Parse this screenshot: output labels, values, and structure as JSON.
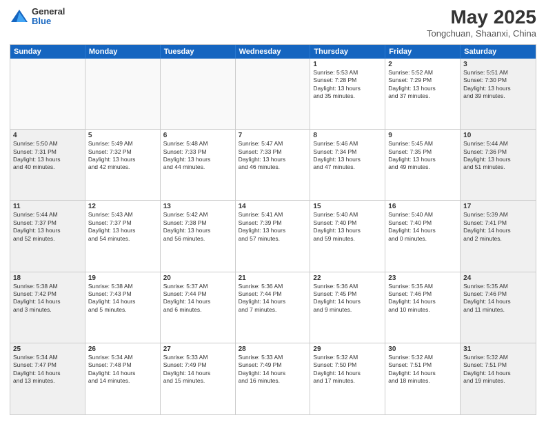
{
  "logo": {
    "general": "General",
    "blue": "Blue"
  },
  "title": "May 2025",
  "location": "Tongchuan, Shaanxi, China",
  "header_days": [
    "Sunday",
    "Monday",
    "Tuesday",
    "Wednesday",
    "Thursday",
    "Friday",
    "Saturday"
  ],
  "weeks": [
    [
      {
        "day": "",
        "info": ""
      },
      {
        "day": "",
        "info": ""
      },
      {
        "day": "",
        "info": ""
      },
      {
        "day": "",
        "info": ""
      },
      {
        "day": "1",
        "info": "Sunrise: 5:53 AM\nSunset: 7:28 PM\nDaylight: 13 hours\nand 35 minutes."
      },
      {
        "day": "2",
        "info": "Sunrise: 5:52 AM\nSunset: 7:29 PM\nDaylight: 13 hours\nand 37 minutes."
      },
      {
        "day": "3",
        "info": "Sunrise: 5:51 AM\nSunset: 7:30 PM\nDaylight: 13 hours\nand 39 minutes."
      }
    ],
    [
      {
        "day": "4",
        "info": "Sunrise: 5:50 AM\nSunset: 7:31 PM\nDaylight: 13 hours\nand 40 minutes."
      },
      {
        "day": "5",
        "info": "Sunrise: 5:49 AM\nSunset: 7:32 PM\nDaylight: 13 hours\nand 42 minutes."
      },
      {
        "day": "6",
        "info": "Sunrise: 5:48 AM\nSunset: 7:33 PM\nDaylight: 13 hours\nand 44 minutes."
      },
      {
        "day": "7",
        "info": "Sunrise: 5:47 AM\nSunset: 7:33 PM\nDaylight: 13 hours\nand 46 minutes."
      },
      {
        "day": "8",
        "info": "Sunrise: 5:46 AM\nSunset: 7:34 PM\nDaylight: 13 hours\nand 47 minutes."
      },
      {
        "day": "9",
        "info": "Sunrise: 5:45 AM\nSunset: 7:35 PM\nDaylight: 13 hours\nand 49 minutes."
      },
      {
        "day": "10",
        "info": "Sunrise: 5:44 AM\nSunset: 7:36 PM\nDaylight: 13 hours\nand 51 minutes."
      }
    ],
    [
      {
        "day": "11",
        "info": "Sunrise: 5:44 AM\nSunset: 7:37 PM\nDaylight: 13 hours\nand 52 minutes."
      },
      {
        "day": "12",
        "info": "Sunrise: 5:43 AM\nSunset: 7:37 PM\nDaylight: 13 hours\nand 54 minutes."
      },
      {
        "day": "13",
        "info": "Sunrise: 5:42 AM\nSunset: 7:38 PM\nDaylight: 13 hours\nand 56 minutes."
      },
      {
        "day": "14",
        "info": "Sunrise: 5:41 AM\nSunset: 7:39 PM\nDaylight: 13 hours\nand 57 minutes."
      },
      {
        "day": "15",
        "info": "Sunrise: 5:40 AM\nSunset: 7:40 PM\nDaylight: 13 hours\nand 59 minutes."
      },
      {
        "day": "16",
        "info": "Sunrise: 5:40 AM\nSunset: 7:40 PM\nDaylight: 14 hours\nand 0 minutes."
      },
      {
        "day": "17",
        "info": "Sunrise: 5:39 AM\nSunset: 7:41 PM\nDaylight: 14 hours\nand 2 minutes."
      }
    ],
    [
      {
        "day": "18",
        "info": "Sunrise: 5:38 AM\nSunset: 7:42 PM\nDaylight: 14 hours\nand 3 minutes."
      },
      {
        "day": "19",
        "info": "Sunrise: 5:38 AM\nSunset: 7:43 PM\nDaylight: 14 hours\nand 5 minutes."
      },
      {
        "day": "20",
        "info": "Sunrise: 5:37 AM\nSunset: 7:44 PM\nDaylight: 14 hours\nand 6 minutes."
      },
      {
        "day": "21",
        "info": "Sunrise: 5:36 AM\nSunset: 7:44 PM\nDaylight: 14 hours\nand 7 minutes."
      },
      {
        "day": "22",
        "info": "Sunrise: 5:36 AM\nSunset: 7:45 PM\nDaylight: 14 hours\nand 9 minutes."
      },
      {
        "day": "23",
        "info": "Sunrise: 5:35 AM\nSunset: 7:46 PM\nDaylight: 14 hours\nand 10 minutes."
      },
      {
        "day": "24",
        "info": "Sunrise: 5:35 AM\nSunset: 7:46 PM\nDaylight: 14 hours\nand 11 minutes."
      }
    ],
    [
      {
        "day": "25",
        "info": "Sunrise: 5:34 AM\nSunset: 7:47 PM\nDaylight: 14 hours\nand 13 minutes."
      },
      {
        "day": "26",
        "info": "Sunrise: 5:34 AM\nSunset: 7:48 PM\nDaylight: 14 hours\nand 14 minutes."
      },
      {
        "day": "27",
        "info": "Sunrise: 5:33 AM\nSunset: 7:49 PM\nDaylight: 14 hours\nand 15 minutes."
      },
      {
        "day": "28",
        "info": "Sunrise: 5:33 AM\nSunset: 7:49 PM\nDaylight: 14 hours\nand 16 minutes."
      },
      {
        "day": "29",
        "info": "Sunrise: 5:32 AM\nSunset: 7:50 PM\nDaylight: 14 hours\nand 17 minutes."
      },
      {
        "day": "30",
        "info": "Sunrise: 5:32 AM\nSunset: 7:51 PM\nDaylight: 14 hours\nand 18 minutes."
      },
      {
        "day": "31",
        "info": "Sunrise: 5:32 AM\nSunset: 7:51 PM\nDaylight: 14 hours\nand 19 minutes."
      }
    ]
  ]
}
